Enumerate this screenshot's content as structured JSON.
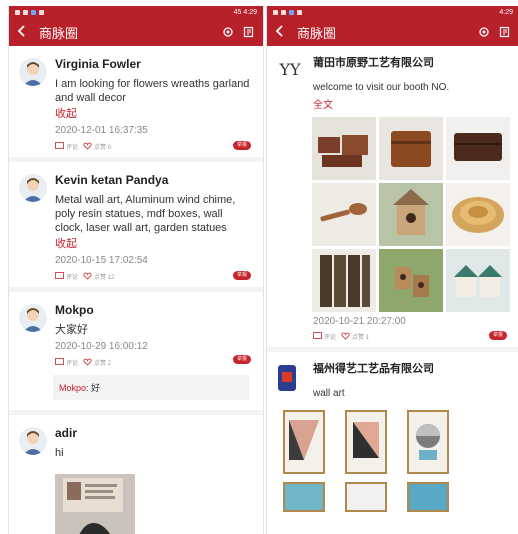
{
  "left": {
    "status": {
      "right": "45 4:29"
    },
    "header": {
      "title": "商脉圈"
    },
    "posts": [
      {
        "name": "Virginia Fowler",
        "text": "I am looking for flowers wreaths garland and wall decor",
        "collapse": "收起",
        "time": "2020-12-01 16:37:35",
        "comment": "评论",
        "like": "点赞 0",
        "tag": "举报"
      },
      {
        "name": "Kevin ketan Pandya",
        "text": "Metal wall art, Aluminum wind chime, poly resin statues, mdf boxes, wall clock, laser wall art, garden statues",
        "collapse": "收起",
        "time": "2020-10-15 17:02:54",
        "comment": "评论",
        "like": "点赞 12",
        "tag": "举报"
      },
      {
        "name": "Mokpo",
        "text": "大家好",
        "time": "2020-10-29 16:00:12",
        "comment": "评论",
        "like": "点赞 2",
        "tag": "举报",
        "reply_user": "Mokpo",
        "reply_text": ": 好"
      },
      {
        "name": "adir",
        "text": "hi"
      }
    ]
  },
  "right": {
    "status": {
      "right": "4:29"
    },
    "header": {
      "title": "商脉圈"
    },
    "posts": [
      {
        "logo": "YY",
        "name": "莆田市原野工艺有限公司",
        "text": "welcome to visit our booth NO.",
        "link": "全文",
        "time": "2020-10-21 20:27:00",
        "comment": "评论",
        "like": "点赞 1",
        "tag": "举报"
      },
      {
        "name": "福州得艺工艺品有限公司",
        "text": "wall art"
      }
    ]
  },
  "colors": {
    "brand": "#b8202a",
    "accent": "#c8232c"
  },
  "icons": [
    "back-arrow-icon",
    "gear-icon",
    "edit-icon",
    "comment-icon",
    "heart-icon"
  ]
}
